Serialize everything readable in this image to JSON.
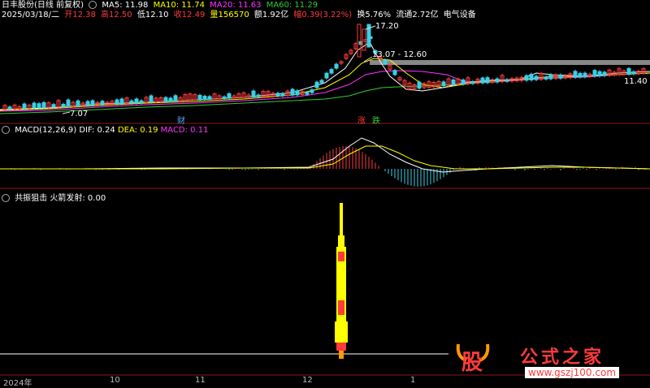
{
  "header": {
    "stock": "日丰股份(日线 前复权)",
    "ma5": "MA5: 11.98",
    "ma10": "MA10: 11.74",
    "ma20": "MA20: 11.63",
    "ma60": "MA60: 11.29",
    "date": "2025/03/18/二",
    "open": "开12.38",
    "high": "高12.50",
    "low": "低12.10",
    "close": "收12.49",
    "volume": "量156570",
    "amount": "额1.92亿",
    "change": "幅0.39(3.22%)",
    "turnover": "换5.76%",
    "float": "流通2.72亿",
    "industry": "电气设备"
  },
  "price_labels": {
    "peak": "17.20",
    "range": "13.07 - 12.60",
    "right": "11.40",
    "left_low": "7.07",
    "cai": "财",
    "zhang": "涨",
    "die": "跌"
  },
  "macd": {
    "title": "MACD(12,26,9)",
    "dif": "DIF: 0.24",
    "dea": "DEA: 0.19",
    "macd": "MACD: 0.11"
  },
  "indicator": {
    "title": "共振狙击",
    "value": "火箭发射: 0.00"
  },
  "axis": {
    "labels": [
      "2024年",
      "10",
      "11",
      "12",
      "1"
    ]
  },
  "watermark": {
    "logo": "股",
    "site": "公式之家",
    "url": "www.gszj100.com"
  },
  "colors": {
    "bg": "#000000",
    "up": "#ff3b3b",
    "down": "#3ad0e8",
    "ma5": "#ffffff",
    "ma10": "#ffff00",
    "ma20": "#ff33ff",
    "ma60": "#33cc33"
  }
}
